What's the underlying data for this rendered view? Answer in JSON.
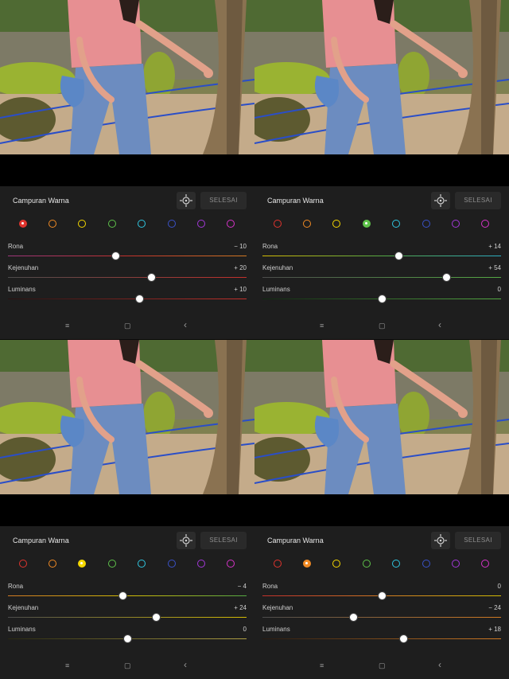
{
  "panels": [
    {
      "title": "Campuran Warna",
      "done_label": "SELESAI",
      "selected_index": 0,
      "sliders": [
        {
          "label": "Rona",
          "value_text": "− 10",
          "value": -10
        },
        {
          "label": "Kejenuhan",
          "value_text": "+ 20",
          "value": 20
        },
        {
          "label": "Luminans",
          "value_text": "+ 10",
          "value": 10
        }
      ]
    },
    {
      "title": "Campuran Warna",
      "done_label": "SELESAI",
      "selected_index": 3,
      "sliders": [
        {
          "label": "Rona",
          "value_text": "+ 14",
          "value": 14
        },
        {
          "label": "Kejenuhan",
          "value_text": "+ 54",
          "value": 54
        },
        {
          "label": "Luminans",
          "value_text": "0",
          "value": 0
        }
      ]
    },
    {
      "title": "Campuran Warna",
      "done_label": "SELESAI",
      "selected_index": 2,
      "sliders": [
        {
          "label": "Rona",
          "value_text": "− 4",
          "value": -4
        },
        {
          "label": "Kejenuhan",
          "value_text": "+ 24",
          "value": 24
        },
        {
          "label": "Luminans",
          "value_text": "0",
          "value": 0
        }
      ]
    },
    {
      "title": "Campuran Warna",
      "done_label": "SELESAI",
      "selected_index": 1,
      "sliders": [
        {
          "label": "Rona",
          "value_text": "0",
          "value": 0
        },
        {
          "label": "Kejenuhan",
          "value_text": "− 24",
          "value": -24
        },
        {
          "label": "Luminans",
          "value_text": "+ 18",
          "value": 18
        }
      ]
    }
  ],
  "color_channels": [
    {
      "name": "red",
      "color": "#e0342e"
    },
    {
      "name": "orange",
      "color": "#f08a24"
    },
    {
      "name": "yellow",
      "color": "#f5d800"
    },
    {
      "name": "green",
      "color": "#5ec24a"
    },
    {
      "name": "aqua",
      "color": "#2fc6e0"
    },
    {
      "name": "blue",
      "color": "#3a52c8"
    },
    {
      "name": "purple",
      "color": "#a238d8"
    },
    {
      "name": "magenta",
      "color": "#d633c8"
    }
  ],
  "slider_range": [
    -100,
    100
  ],
  "nav_icons": {
    "menu": "≡",
    "home": "▢",
    "back": "‹"
  }
}
